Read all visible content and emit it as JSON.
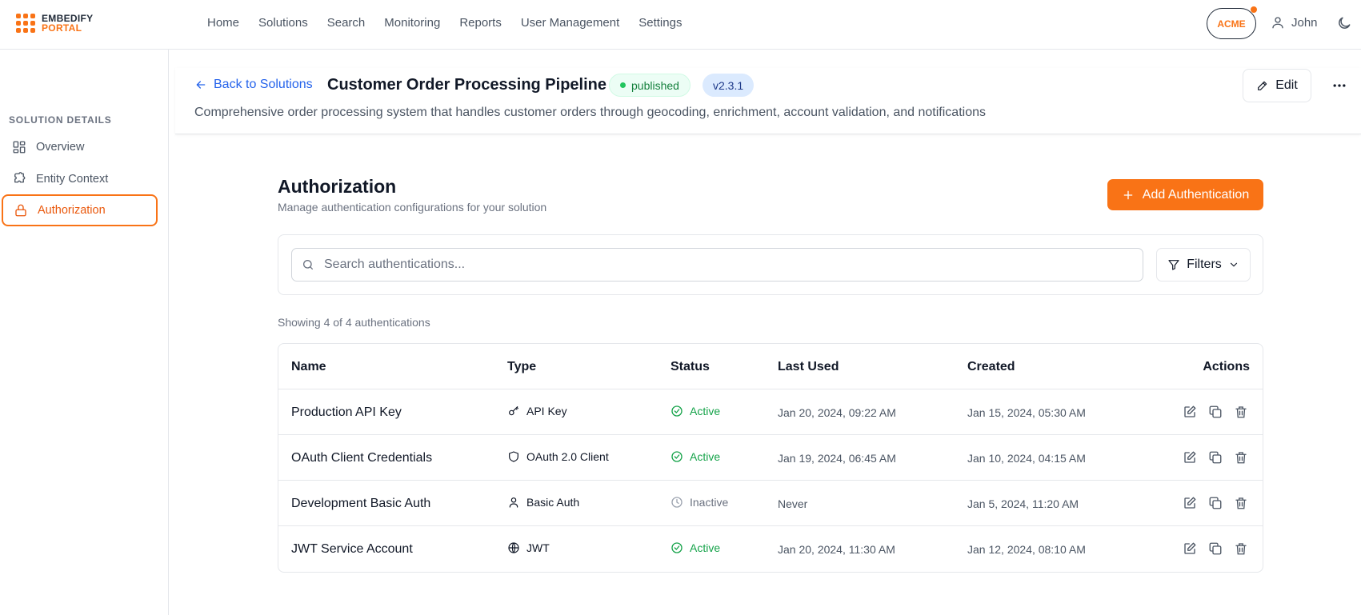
{
  "brand": {
    "line1": "EMBEDIFY",
    "line2": "PORTAL",
    "color": "#f97316"
  },
  "nav": [
    "Home",
    "Solutions",
    "Search",
    "Monitoring",
    "Reports",
    "User Management",
    "Settings"
  ],
  "org_badge": "ACME",
  "user_name": "John",
  "sidebar": {
    "heading": "SOLUTION DETAILS",
    "items": [
      {
        "label": "Overview",
        "icon": "grid-icon"
      },
      {
        "label": "Entity Context",
        "icon": "puzzle-icon"
      },
      {
        "label": "Authorization",
        "icon": "lock-icon",
        "active": true
      }
    ]
  },
  "header": {
    "back_label": "Back to Solutions",
    "title": "Customer Order Processing Pipeline",
    "status_badge": "published",
    "version_badge": "v2.3.1",
    "description": "Comprehensive order processing system that handles customer orders through geocoding, enrichment, account validation, and notifications",
    "edit_label": "Edit"
  },
  "auth": {
    "title": "Authorization",
    "subtitle": "Manage authentication configurations for your solution",
    "add_button": "Add Authentication",
    "search_placeholder": "Search authentications...",
    "filters_label": "Filters",
    "showing_text": "Showing 4 of 4 authentications",
    "columns": [
      "Name",
      "Type",
      "Status",
      "Last Used",
      "Created",
      "Actions"
    ],
    "rows": [
      {
        "name": "Production API Key",
        "type": "API Key",
        "type_icon": "key-icon",
        "status": "Active",
        "last_used": "Jan 20, 2024, 09:22 AM",
        "created": "Jan 15, 2024, 05:30 AM"
      },
      {
        "name": "OAuth Client Credentials",
        "type": "OAuth 2.0 Client",
        "type_icon": "shield-icon",
        "status": "Active",
        "last_used": "Jan 19, 2024, 06:45 AM",
        "created": "Jan 10, 2024, 04:15 AM"
      },
      {
        "name": "Development Basic Auth",
        "type": "Basic Auth",
        "type_icon": "user-icon",
        "status": "Inactive",
        "last_used": "Never",
        "created": "Jan 5, 2024, 11:20 AM"
      },
      {
        "name": "JWT Service Account",
        "type": "JWT",
        "type_icon": "globe-icon",
        "status": "Active",
        "last_used": "Jan 20, 2024, 11:30 AM",
        "created": "Jan 12, 2024, 08:10 AM"
      }
    ]
  },
  "colors": {
    "accent": "#f97316",
    "link": "#2563eb",
    "active": "#16a34a",
    "inactive": "#6b7280"
  }
}
